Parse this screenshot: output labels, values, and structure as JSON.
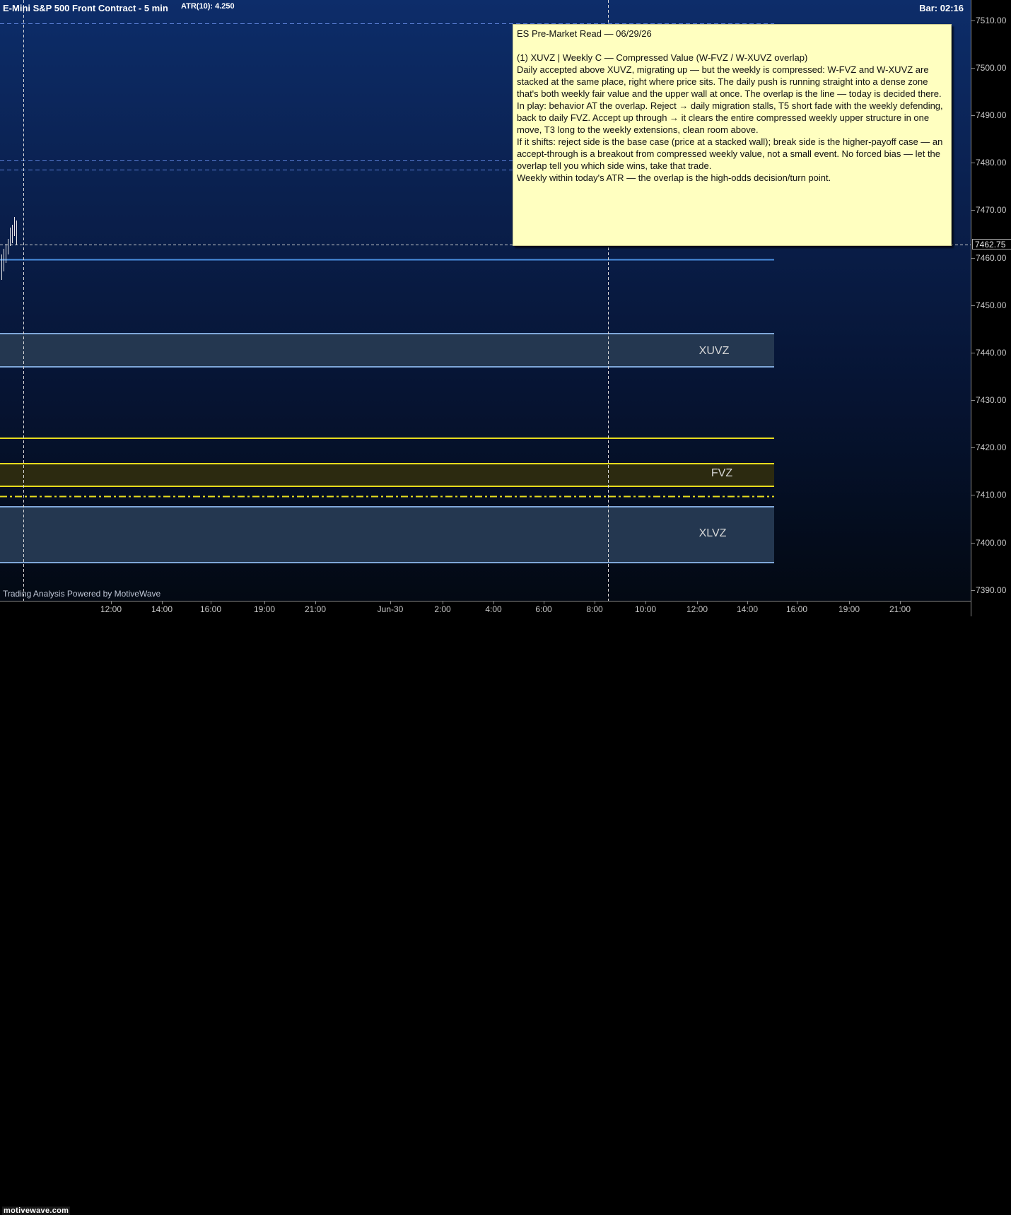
{
  "header": {
    "title": "E-Mini S&P 500 Front Contract - 5 min",
    "atr": "ATR(10): 4.250",
    "bar_timer": "Bar: 02:16"
  },
  "price_axis": {
    "labels": [
      "7510.00",
      "7500.00",
      "7490.00",
      "7480.00",
      "7470.00",
      "7460.00",
      "7450.00",
      "7440.00",
      "7430.00",
      "7420.00",
      "7410.00",
      "7400.00",
      "7390.00"
    ],
    "current_price": "7462.75"
  },
  "time_axis": {
    "labels": [
      "12:00",
      "14:00",
      "16:00",
      "19:00",
      "21:00",
      "Jun-30",
      "2:00",
      "4:00",
      "6:00",
      "8:00",
      "10:00",
      "12:00",
      "14:00",
      "16:00",
      "19:00",
      "21:00"
    ]
  },
  "zones": {
    "xuvz_label": "XUVZ",
    "fvz_label": "FVZ",
    "xlvz_label": "XLVZ"
  },
  "note": {
    "title": "ES Pre-Market Read — 06/29/26",
    "heading": "(1) XUVZ | Weekly C — Compressed Value (W-FVZ / W-XUVZ overlap)",
    "para1": "Daily accepted above XUVZ, migrating up — but the weekly is compressed: W-FVZ and W-XUVZ are stacked at the same place, right where price sits. The daily push is running straight into a dense zone that's both weekly fair value and the upper wall at once. The overlap is the line — today is decided there.",
    "para2": "In play: behavior AT the overlap. Reject → daily migration stalls, T5 short fade with the weekly defending, back to daily FVZ. Accept up through → it clears the entire compressed weekly upper structure in one move, T3 long to the weekly extensions, clean room above.",
    "para3": "If it shifts: reject side is the base case (price at a stacked wall); break side is the higher-payoff case — an accept-through is a breakout from compressed weekly value, not a small event. No forced bias — let the overlap tell you which side wins, take that trade.",
    "para4": "Weekly within today's ATR — the overlap is the high-odds decision/turn point."
  },
  "footer": {
    "watermark": "Trading Analysis Powered by MotiveWave",
    "logo": "motivewave.com"
  },
  "colors": {
    "zone_blue_line": "#7fa7d9",
    "zone_fill": "#243750",
    "yellow_line": "#e6dc1e",
    "fvz_fill": "#2c2a10",
    "current_price_line": "#4a8fe0",
    "note_bg": "#ffffc0"
  }
}
